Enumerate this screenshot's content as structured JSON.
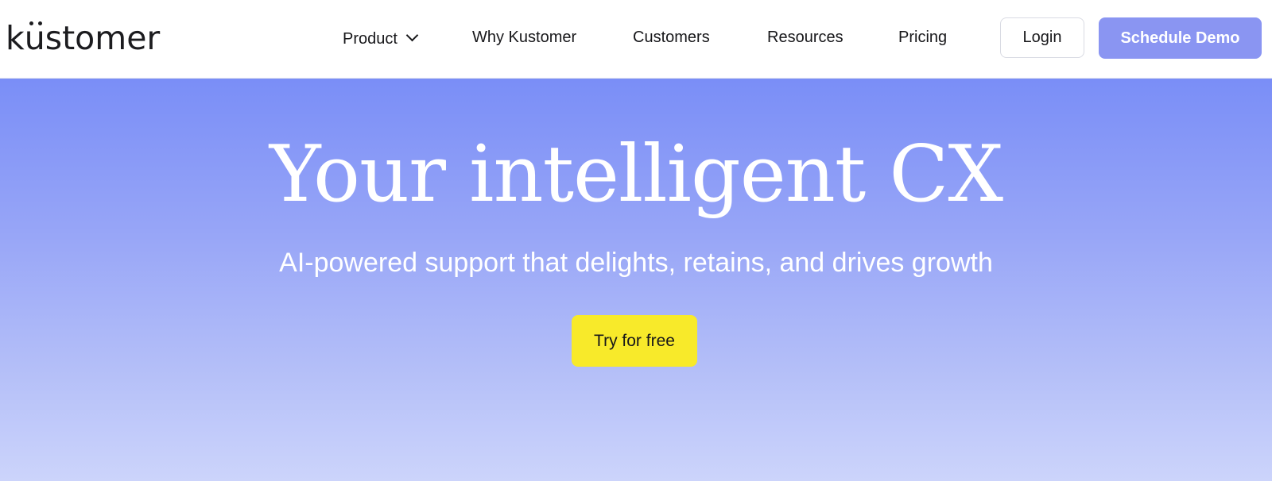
{
  "brand": {
    "logo_prefix": "k",
    "logo_u": "u",
    "logo_suffix": "stomer",
    "logo_text": "kustomer"
  },
  "nav": {
    "items": [
      {
        "label": "Product",
        "has_dropdown": true,
        "icon": "chevron-down-icon"
      },
      {
        "label": "Why Kustomer"
      },
      {
        "label": "Customers"
      },
      {
        "label": "Resources"
      },
      {
        "label": "Pricing"
      }
    ],
    "login_label": "Login",
    "demo_label": "Schedule Demo"
  },
  "hero": {
    "title": "Your intelligent CX",
    "subtitle": "AI-powered support that delights, retains, and drives growth",
    "cta_label": "Try for free"
  },
  "colors": {
    "accent": "#8a95f2",
    "hero_top": "#7a8ef7",
    "hero_bottom": "#ccd4fb",
    "cta": "#f8ea2a",
    "text_dark": "#17171a"
  }
}
